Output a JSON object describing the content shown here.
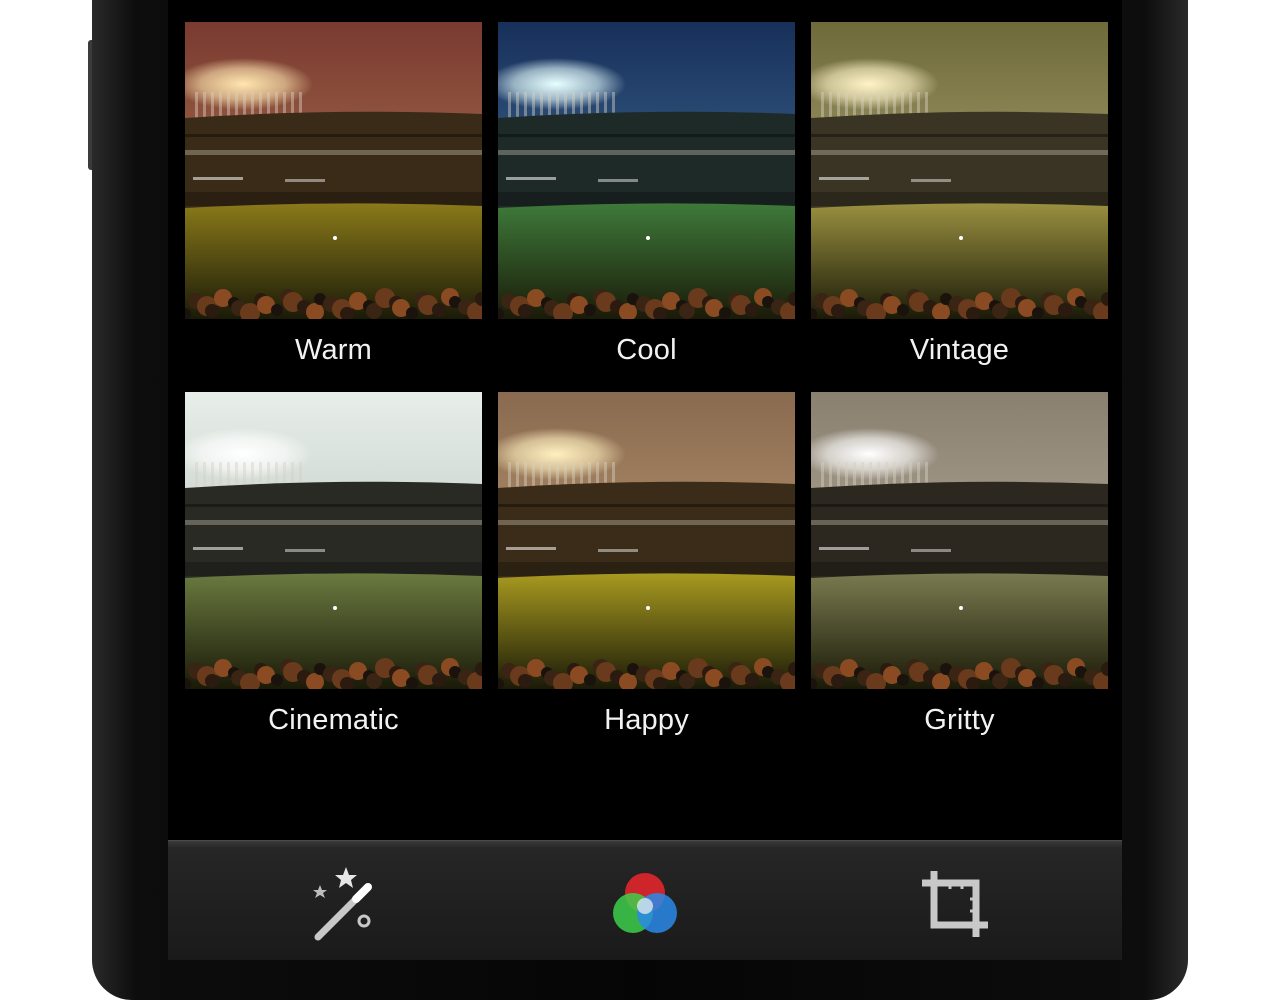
{
  "filters": [
    {
      "label": "Warm",
      "sky": "#b8845a",
      "sky_top": "#7a3a30",
      "stands": "#3a2a18",
      "field": "#8a7a1a",
      "light": "#ffe6b0"
    },
    {
      "label": "Cool",
      "sky": "#4e7fa8",
      "sky_top": "#17305a",
      "stands": "#1e2a28",
      "field": "#3e7a3a",
      "light": "#e8ffff"
    },
    {
      "label": "Vintage",
      "sky": "#c2b58a",
      "sky_top": "#6e6a3a",
      "stands": "#3a3424",
      "field": "#9a9040",
      "light": "#fff4c8"
    },
    {
      "label": "Cinematic",
      "sky": "#a9b8b0",
      "sky_top": "#e8eeea",
      "stands": "#2a2a24",
      "field": "#6a7a40",
      "light": "#ffffff"
    },
    {
      "label": "Happy",
      "sky": "#c8a878",
      "sky_top": "#8a6a50",
      "stands": "#3a2c18",
      "field": "#a89a20",
      "light": "#fff0c0"
    },
    {
      "label": "Gritty",
      "sky": "#c0b8a8",
      "sky_top": "#8a8070",
      "stands": "#2c2820",
      "field": "#7a7a50",
      "light": "#ffffff"
    }
  ],
  "toolbar": {
    "auto_enhance_icon": "magic-wand-icon",
    "filters_icon": "color-circles-icon",
    "crop_icon": "crop-icon"
  },
  "colors": {
    "circle_red": "#e0262a",
    "circle_green": "#3ccf4a",
    "circle_blue": "#2a8ae8",
    "icon_gray": "#c8c8c8"
  }
}
